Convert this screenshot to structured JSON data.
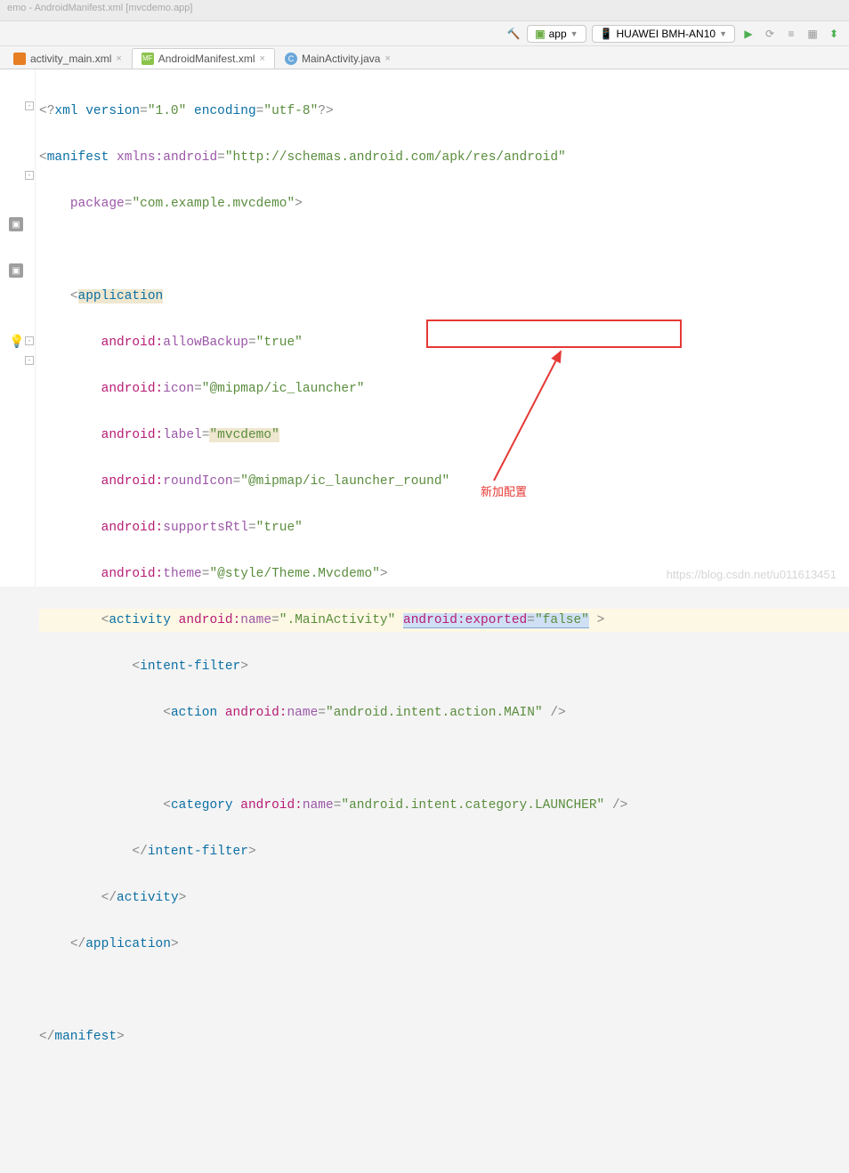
{
  "titlebar": "emo - AndroidManifest.xml [mvcdemo.app]",
  "toolbar": {
    "config_app": "app",
    "config_device": "HUAWEI BMH-AN10"
  },
  "tabs": [
    {
      "label": "activity_main.xml",
      "icon": "xml",
      "active": false
    },
    {
      "label": "AndroidManifest.xml",
      "icon": "mf",
      "active": true
    },
    {
      "label": "MainActivity.java",
      "icon": "java",
      "active": false
    }
  ],
  "code": {
    "xml_decl_version": "\"1.0\"",
    "xml_decl_enc": "\"utf-8\"",
    "manifest_xmlns_attr": "xmlns:android",
    "manifest_xmlns_val": "\"http://schemas.android.com/apk/res/android\"",
    "package_val": "\"com.example.mvcdemo\"",
    "allowBackup": "\"true\"",
    "icon": "\"@mipmap/ic_launcher\"",
    "label": "\"mvcdemo\"",
    "roundIcon": "\"@mipmap/ic_launcher_round\"",
    "supportsRtl": "\"true\"",
    "theme": "\"@style/Theme.Mvcdemo\"",
    "activity_name": "\".MainActivity\"",
    "exported_attr": "android:exported",
    "exported_val": "\"false\"",
    "action_name": "\"android.intent.action.MAIN\"",
    "category_name": "\"android.intent.category.LAUNCHER\""
  },
  "annotation": "新加配置",
  "watermark": "https://blog.csdn.net/u011613451"
}
